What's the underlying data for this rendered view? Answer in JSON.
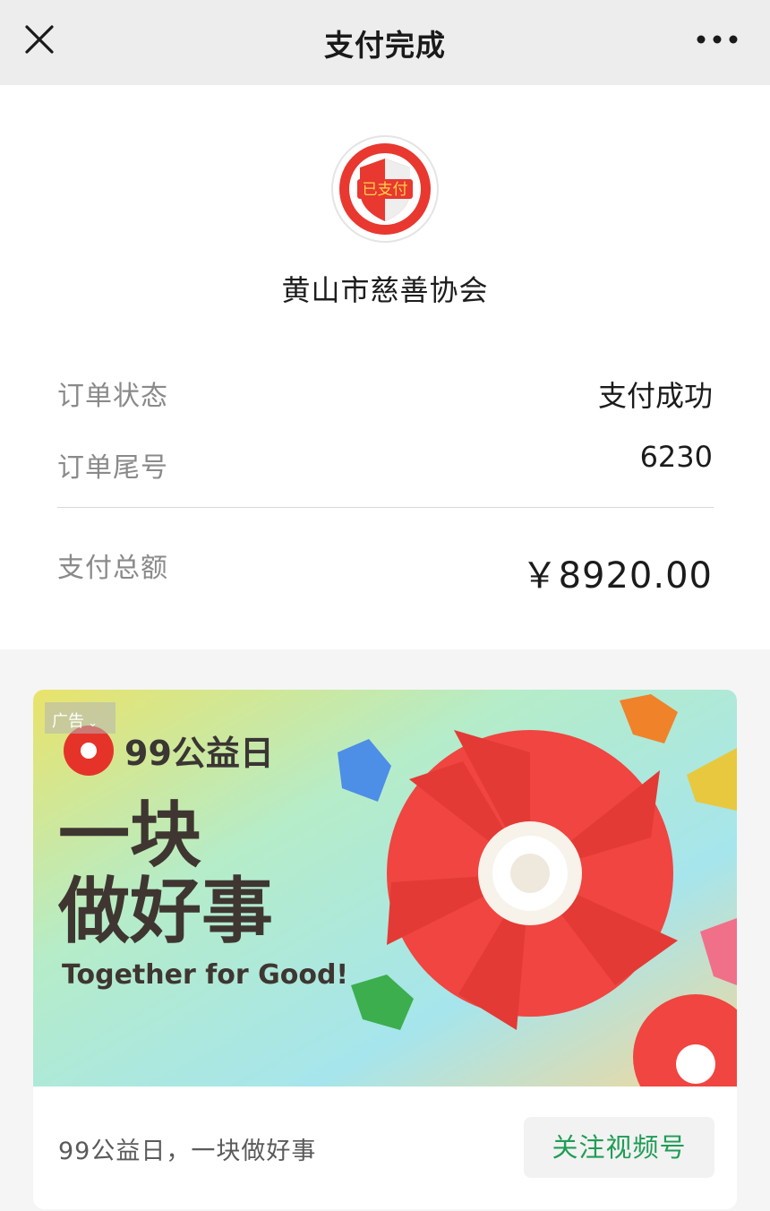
{
  "header": {
    "title": "支付完成",
    "close_icon": "close-icon",
    "more_icon": "more-icon"
  },
  "merchant": {
    "logo_icon": "paid-shield-icon",
    "logo_text": "已支付",
    "name": "黄山市慈善协会"
  },
  "order": {
    "status_label": "订单状态",
    "status_value": "支付成功",
    "tail_label": "订单尾号",
    "tail_value": "6230",
    "total_label": "支付总额",
    "total_value": "￥8920.00"
  },
  "ad": {
    "tag": "广告",
    "badge_text": "99公益日",
    "headline_line1": "一块",
    "headline_line2": "做好事",
    "slogan": "Together for Good!",
    "caption": "99公益日，一块做好事",
    "follow_label": "关注视频号"
  },
  "colors": {
    "accent_green": "#1f9d55",
    "shield_red": "#e8382f",
    "flower_red": "#f04540"
  }
}
